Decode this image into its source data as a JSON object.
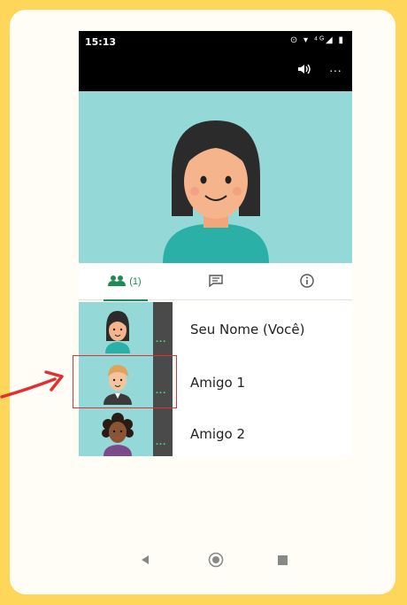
{
  "status_bar": {
    "time": "15:13",
    "icons": "⊙ ▾ ⁴ᴳ◢ ▮"
  },
  "call": {
    "speaker_icon": "speaker-icon",
    "more_label": "···"
  },
  "tabs": {
    "participants_count": "(1)",
    "items": [
      "participants",
      "chat",
      "info"
    ]
  },
  "participants": [
    {
      "name": "Seu Nome (Você)",
      "dots": "..."
    },
    {
      "name": "Amigo 1",
      "dots": "..."
    },
    {
      "name": "Amigo 2",
      "dots": "..."
    }
  ],
  "colors": {
    "frame": "#fdd65a",
    "accent_green": "#1f8a56",
    "video_bg": "#95d8d8",
    "highlight": "#e03030"
  }
}
